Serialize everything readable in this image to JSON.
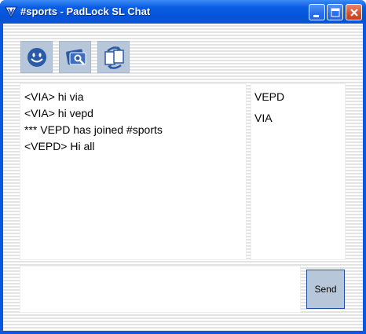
{
  "window": {
    "title": "#sports - PadLock SL Chat",
    "app_icon": "v-shield-icon",
    "controls": [
      "minimize-icon",
      "maximize-icon",
      "close-icon"
    ]
  },
  "toolbar": {
    "buttons": [
      {
        "icon": "smiley-icon"
      },
      {
        "icon": "photo-search-icon"
      },
      {
        "icon": "swap-arrows-icon"
      }
    ]
  },
  "chat": {
    "lines": [
      "<VIA> hi via",
      "<VIA> hi vepd",
      "*** VEPD has joined #sports",
      "<VEPD> Hi all"
    ]
  },
  "users": [
    "VEPD",
    "VIA"
  ],
  "composer": {
    "message_value": "",
    "send_label": "Send"
  },
  "colors": {
    "titlebar": "#0a58e0",
    "toolbar_button": "#b7c6d8",
    "close_button": "#d8502e"
  }
}
